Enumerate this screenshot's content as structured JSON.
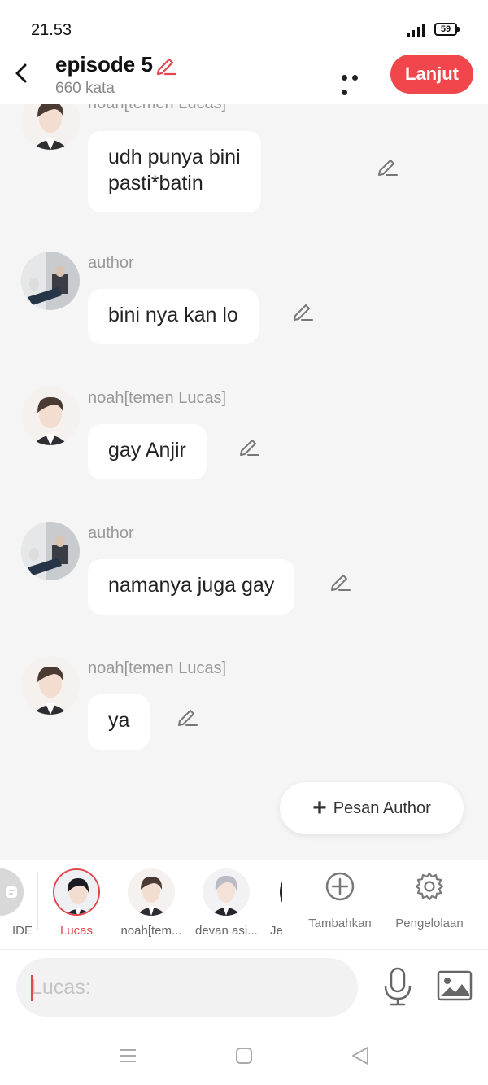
{
  "status": {
    "time": "21.53",
    "battery": "59"
  },
  "header": {
    "title": "episode 5",
    "subtitle": "660 kata",
    "next_label": "Lanjut"
  },
  "messages": [
    {
      "sender": "noah[temen Lucas]",
      "text_line1": "udh punya bini",
      "text_line2": "pasti*batin"
    },
    {
      "sender": "author",
      "text": "bini nya kan lo"
    },
    {
      "sender": "noah[temen Lucas]",
      "text": "gay Anjir"
    },
    {
      "sender": "author",
      "text": "namanya juga gay"
    },
    {
      "sender": "noah[temen Lucas]",
      "text": "ya"
    }
  ],
  "pesan_author": {
    "label": "Pesan Author"
  },
  "characters": [
    {
      "label": "IDE"
    },
    {
      "label": "Lucas"
    },
    {
      "label": "noah[tem..."
    },
    {
      "label": "devan asi..."
    },
    {
      "label": "Je"
    }
  ],
  "tools": {
    "add_label": "Tambahkan",
    "manage_label": "Pengelolaan"
  },
  "input": {
    "placeholder": "Lucas:"
  },
  "colors": {
    "accent": "#f0464c",
    "background": "#f5f5f5"
  }
}
